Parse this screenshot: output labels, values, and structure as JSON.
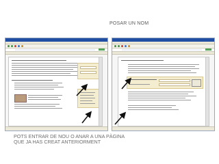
{
  "slide": {
    "title": "POSAR UN NOM",
    "caption": "POTS ENTRAR DE NOU O ANAR A UNA PÀGINA QUE JA HAS CREAT ANTERIORMENT"
  },
  "colors": {
    "titlebar": "#1f4ea3",
    "arrow": "#111111",
    "form_highlight": "#f5edd0"
  },
  "icons": [
    "back-icon",
    "forward-icon",
    "stop-icon",
    "refresh-icon",
    "home-icon",
    "go-button-icon",
    "pointer-arrow-icon"
  ]
}
